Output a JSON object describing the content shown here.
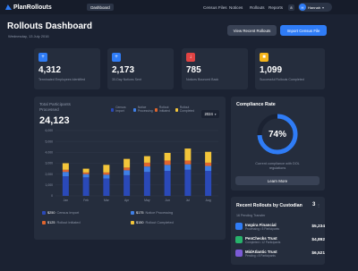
{
  "nav": {
    "logo": "PlanRollouts",
    "tab": "Dashboard",
    "links": [
      "Census Files",
      "Notices",
      "Rollouts",
      "Reports"
    ],
    "badge": "8",
    "user_initials": "H",
    "user_name": "Hannah"
  },
  "header": {
    "title": "Rollouts Dashboard",
    "date": "Wednesday, 13 July 2016",
    "btn_recent": "View Recent Rollouts",
    "btn_import": "Import Census File"
  },
  "stats": [
    {
      "icon": "+",
      "value": "4,312",
      "label": "Terminated Employees Identified",
      "color": "#2f7cf6"
    },
    {
      "icon": "+",
      "value": "2,173",
      "label": "30-Day Notices Sent",
      "color": "#2f7cf6"
    },
    {
      "icon": "↓",
      "value": "785",
      "label": "Notices Bounced Back",
      "color": "#e04343"
    },
    {
      "icon": "■",
      "value": "1,099",
      "label": "Successful Rollouts Completed",
      "color": "#f4b41a"
    }
  ],
  "chart": {
    "title": "Total Participants Processed",
    "total": "24,123",
    "year": "2024",
    "legend_top": [
      "Census Import",
      "Notice Processing",
      "Rollout Initiated",
      "Rollout Completed"
    ],
    "legend_bottom": [
      {
        "value": "$250",
        "label": "Census Import"
      },
      {
        "value": "$175",
        "label": "Notice Processing"
      },
      {
        "value": "$125",
        "label": "Rollout Initiated"
      },
      {
        "value": "$150",
        "label": "Rollout Completed"
      }
    ]
  },
  "chart_data": {
    "type": "bar",
    "stacked": true,
    "categories": [
      "Jan",
      "Feb",
      "Mar",
      "Apr",
      "May",
      "Jun",
      "Jul",
      "Aug"
    ],
    "y_ticks": [
      "0",
      "1,000",
      "2,000",
      "3,000",
      "4,000",
      "5,000",
      "6,000"
    ],
    "ylim": [
      0,
      6000
    ],
    "colors": [
      "#2a49b8",
      "#3f7fe6",
      "#e0652e",
      "#f3c53a"
    ],
    "series": [
      {
        "name": "Census Import",
        "values": [
          1800,
          1700,
          1600,
          1900,
          2200,
          2300,
          2400,
          2300
        ]
      },
      {
        "name": "Notice Processing",
        "values": [
          400,
          300,
          350,
          450,
          500,
          550,
          500,
          450
        ]
      },
      {
        "name": "Rollout Initiated",
        "values": [
          200,
          150,
          200,
          250,
          350,
          400,
          350,
          300
        ]
      },
      {
        "name": "Rollout Completed",
        "values": [
          600,
          350,
          700,
          800,
          600,
          700,
          1100,
          1000
        ]
      }
    ]
  },
  "compliance": {
    "title": "Compliance Rate",
    "percent": 74,
    "percent_label": "74%",
    "caption": "Current compliance with DOL regulations",
    "button": "Learn More",
    "ring_color": "#2f7cf6"
  },
  "recent": {
    "title": "Recent Rollouts by Custodian",
    "count": "3",
    "subtitle": "16 Pending Transfer",
    "items": [
      {
        "name": "Inspira Financial",
        "sub": "Processing • 5 Participants",
        "amount": "$5,234",
        "color": "#2f7cf6"
      },
      {
        "name": "PenChecks Trust",
        "sub": "Completed • 12 Participants",
        "amount": "$4,892",
        "color": "#27b36b"
      },
      {
        "name": "MidAtlantic Trust",
        "sub": "Pending • 8 Participants",
        "amount": "$6,521",
        "color": "#7b5bd6"
      }
    ]
  }
}
